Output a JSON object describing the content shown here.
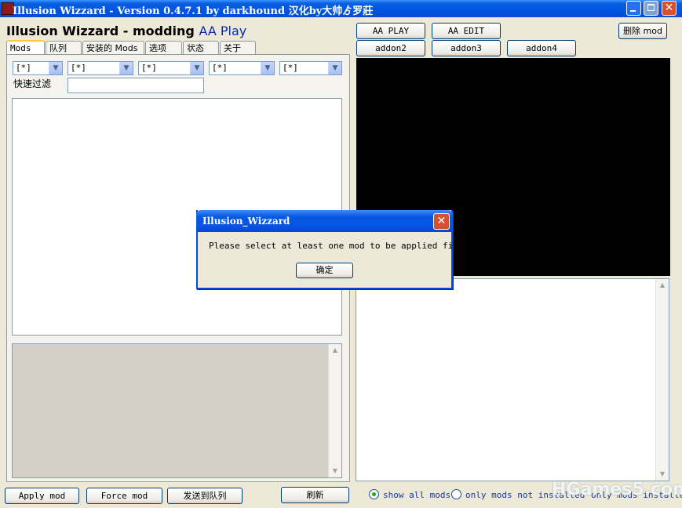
{
  "window": {
    "title": "Illusion Wizzard - Version 0.4.7.1 by darkhound 汉化by大帅ゟ罗莊",
    "min_icon": "minimize-icon",
    "max_icon": "maximize-icon",
    "close_glyph": "✕"
  },
  "header": {
    "title_prefix": "Illusion Wizzard - modding",
    "title_game": "AA Play",
    "accent_color": "#0a2aa8"
  },
  "tabs": [
    "Mods",
    "队列",
    "安装的 Mods",
    "选项",
    "状态",
    "关于"
  ],
  "filters": {
    "combos": [
      "[*]",
      "[*]",
      "[*]",
      "[*]",
      "[*]"
    ],
    "quick_filter_label": "快速过滤",
    "quick_filter_value": ""
  },
  "launch_buttons": {
    "aa_play": "AA PLAY",
    "aa_edit": "AA EDIT",
    "addon2": "addon2",
    "addon3": "addon3",
    "addon4": "addon4",
    "delete_mod": "删除 mod"
  },
  "bottom_buttons": {
    "apply": "Apply mod",
    "force": "Force mod",
    "queue": "发送到队列",
    "refresh": "刷新"
  },
  "view_options": {
    "show_all": "show all mods",
    "only_not_installed": "only mods not installed",
    "only_installed": "only mods installe",
    "selected": "show_all"
  },
  "watermark": "HGames5.com",
  "dialog": {
    "title": "Illusion_Wizzard",
    "message": "Please select at least one mod to be applied first",
    "ok": "确定",
    "close_glyph": "✕"
  }
}
